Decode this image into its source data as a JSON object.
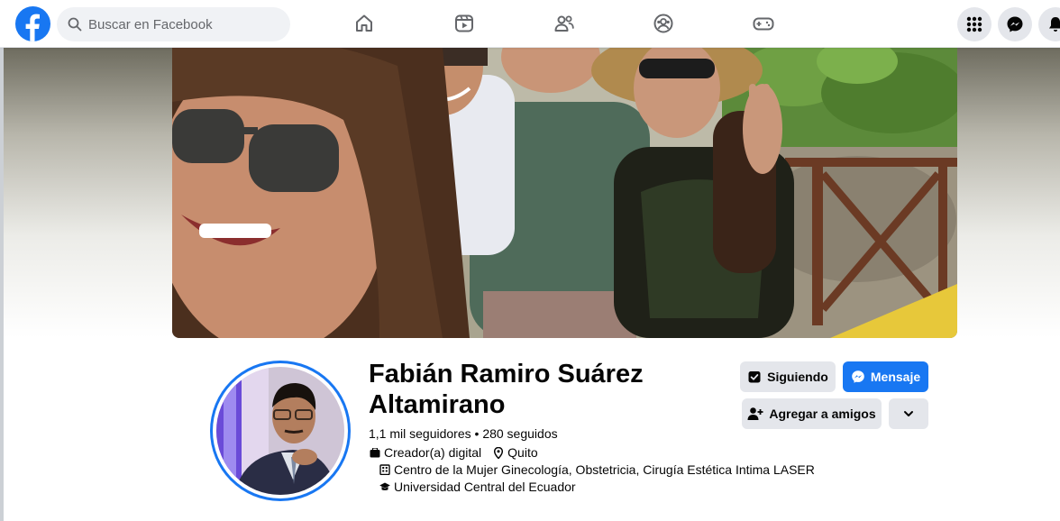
{
  "topbar": {
    "search_placeholder": "Buscar en Facebook",
    "nav": [
      "home-icon",
      "video-icon",
      "friends-icon",
      "groups-icon",
      "gaming-icon"
    ],
    "right": [
      "menu-grid-icon",
      "messenger-icon",
      "notifications-icon"
    ]
  },
  "profile": {
    "name": "Fabián Ramiro Suárez Altamirano",
    "followers": "1,1 mil seguidores",
    "separator": " • ",
    "following": "280 seguidos",
    "category": "Creador(a) digital",
    "location": "Quito",
    "workplace": "Centro de la Mujer Ginecología, Obstetricia, Cirugía Estética Intima LASER",
    "education": "Universidad Central del Ecuador"
  },
  "actions": {
    "following_label": "Siguiendo",
    "message_label": "Mensaje",
    "add_friend_label": "Agregar a amigos"
  },
  "colors": {
    "brand": "#1877f2",
    "button_gray": "#e4e6eb"
  }
}
